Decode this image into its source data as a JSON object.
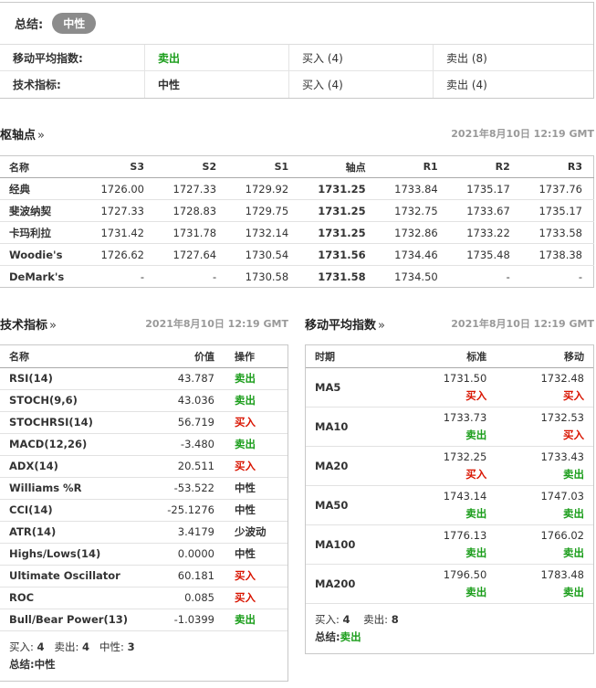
{
  "summary": {
    "label": "总结:",
    "badge": "中性",
    "rows": [
      {
        "name": "移动平均指数:",
        "verdict": "卖出",
        "verdict_class": "sell",
        "buy": "买入 (4)",
        "sell": "卖出 (8)"
      },
      {
        "name": "技术指标:",
        "verdict": "中性",
        "verdict_class": "neutral",
        "buy": "买入 (4)",
        "sell": "卖出 (4)"
      }
    ]
  },
  "pivot": {
    "title": "枢轴点",
    "arrow": "»",
    "timestamp": "2021年8月10日 12:19 GMT",
    "headers": [
      "名称",
      "S3",
      "S2",
      "S1",
      "轴点",
      "R1",
      "R2",
      "R3"
    ],
    "rows": [
      [
        "经典",
        "1726.00",
        "1727.33",
        "1729.92",
        "1731.25",
        "1733.84",
        "1735.17",
        "1737.76"
      ],
      [
        "斐波纳契",
        "1727.33",
        "1728.83",
        "1729.75",
        "1731.25",
        "1732.75",
        "1733.67",
        "1735.17"
      ],
      [
        "卡玛利拉",
        "1731.42",
        "1731.78",
        "1732.14",
        "1731.25",
        "1732.86",
        "1733.22",
        "1733.58"
      ],
      [
        "Woodie's",
        "1726.62",
        "1727.64",
        "1730.54",
        "1731.56",
        "1734.46",
        "1735.48",
        "1738.38"
      ],
      [
        "DeMark's",
        "-",
        "-",
        "1730.58",
        "1731.58",
        "1734.50",
        "-",
        "-"
      ]
    ]
  },
  "tech": {
    "title": "技术指标",
    "arrow": "»",
    "timestamp": "2021年8月10日 12:19 GMT",
    "headers": [
      "名称",
      "价值",
      "操作"
    ],
    "rows": [
      {
        "name": "RSI(14)",
        "value": "43.787",
        "action": "卖出",
        "cls": "sell"
      },
      {
        "name": "STOCH(9,6)",
        "value": "43.036",
        "action": "卖出",
        "cls": "sell"
      },
      {
        "name": "STOCHRSI(14)",
        "value": "56.719",
        "action": "买入",
        "cls": "buy"
      },
      {
        "name": "MACD(12,26)",
        "value": "-3.480",
        "action": "卖出",
        "cls": "sell"
      },
      {
        "name": "ADX(14)",
        "value": "20.511",
        "action": "买入",
        "cls": "buy"
      },
      {
        "name": "Williams %R",
        "value": "-53.522",
        "action": "中性",
        "cls": "neutral"
      },
      {
        "name": "CCI(14)",
        "value": "-25.1276",
        "action": "中性",
        "cls": "neutral"
      },
      {
        "name": "ATR(14)",
        "value": "3.4179",
        "action": "少波动",
        "cls": "neutral"
      },
      {
        "name": "Highs/Lows(14)",
        "value": "0.0000",
        "action": "中性",
        "cls": "neutral"
      },
      {
        "name": "Ultimate Oscillator",
        "value": "60.181",
        "action": "买入",
        "cls": "buy"
      },
      {
        "name": "ROC",
        "value": "0.085",
        "action": "买入",
        "cls": "buy"
      },
      {
        "name": "Bull/Bear Power(13)",
        "value": "-1.0399",
        "action": "卖出",
        "cls": "sell"
      }
    ],
    "footer": {
      "buy_label": "买入:",
      "buy_count": "4",
      "sell_label": "卖出:",
      "sell_count": "4",
      "neutral_label": "中性:",
      "neutral_count": "3",
      "summary_label": "总结:",
      "summary_value": "中性"
    }
  },
  "ma": {
    "title": "移动平均指数",
    "arrow": "»",
    "timestamp": "2021年8月10日 12:19 GMT",
    "headers": [
      "时期",
      "标准",
      "移动"
    ],
    "rows": [
      {
        "period": "MA5",
        "simple": "1731.50",
        "simple_sig": "买入",
        "simple_cls": "buy",
        "exp": "1732.48",
        "exp_sig": "买入",
        "exp_cls": "buy"
      },
      {
        "period": "MA10",
        "simple": "1733.73",
        "simple_sig": "卖出",
        "simple_cls": "sell",
        "exp": "1732.53",
        "exp_sig": "买入",
        "exp_cls": "buy"
      },
      {
        "period": "MA20",
        "simple": "1732.25",
        "simple_sig": "买入",
        "simple_cls": "buy",
        "exp": "1733.43",
        "exp_sig": "卖出",
        "exp_cls": "sell"
      },
      {
        "period": "MA50",
        "simple": "1743.14",
        "simple_sig": "卖出",
        "simple_cls": "sell",
        "exp": "1747.03",
        "exp_sig": "卖出",
        "exp_cls": "sell"
      },
      {
        "period": "MA100",
        "simple": "1776.13",
        "simple_sig": "卖出",
        "simple_cls": "sell",
        "exp": "1766.02",
        "exp_sig": "卖出",
        "exp_cls": "sell"
      },
      {
        "period": "MA200",
        "simple": "1796.50",
        "simple_sig": "卖出",
        "simple_cls": "sell",
        "exp": "1783.48",
        "exp_sig": "卖出",
        "exp_cls": "sell"
      }
    ],
    "footer": {
      "buy_label": "买入:",
      "buy_count": "4",
      "sell_label": "卖出:",
      "sell_count": "8",
      "summary_label": "总结:",
      "summary_value": "卖出"
    }
  }
}
